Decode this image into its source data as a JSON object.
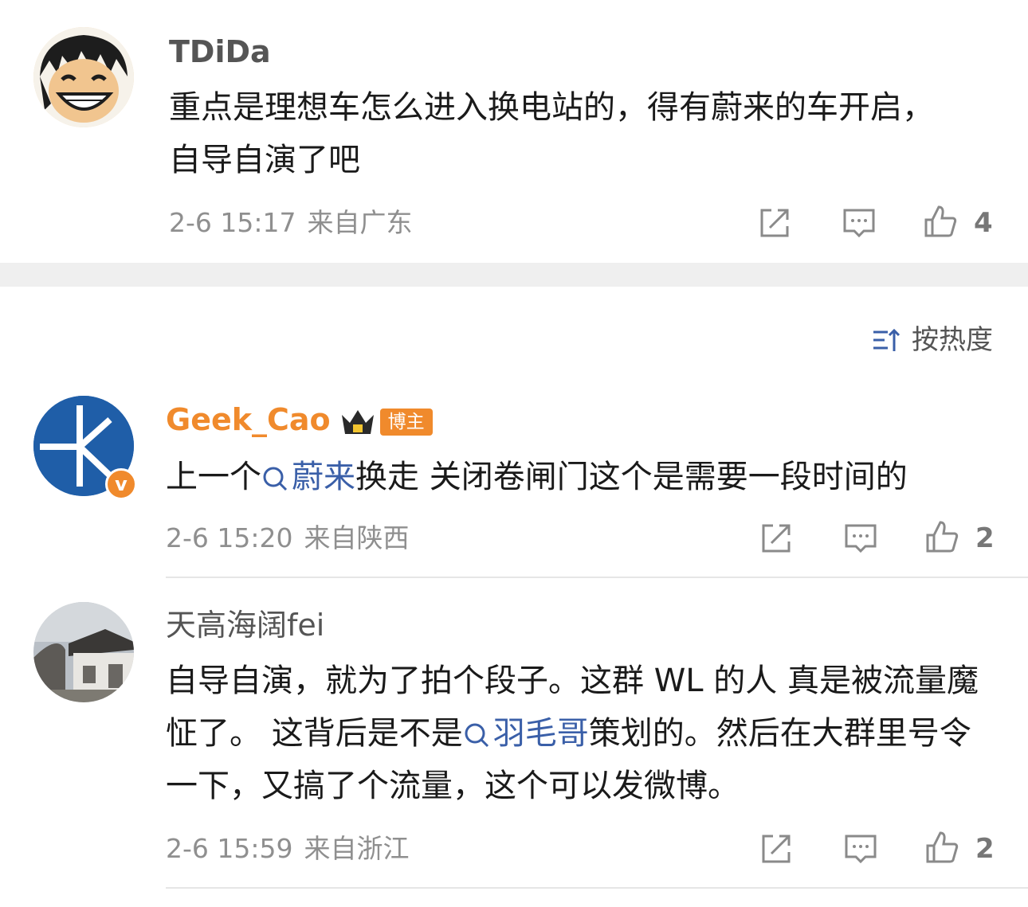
{
  "comments": [
    {
      "username": "TDiDa",
      "text": "重点是理想车怎么进入换电站的，得有蔚来的车开启，自导自演了吧",
      "time": "2-6 15:17",
      "source": "来自广东",
      "likes": "4",
      "avatar_icon": "cartoon-avatar-icon"
    },
    {
      "username": "Geek_Cao",
      "host_badge": "博主",
      "text_before": "上一个",
      "topic": "蔚来",
      "text_after": "换走 关闭卷闸门这个是需要一段时间的",
      "time": "2-6 15:20",
      "source": "来自陕西",
      "likes": "2",
      "verified_mark": "v"
    },
    {
      "username": "天高海阔fei",
      "text_before": "自导自演，就为了拍个段子。这群 WL 的人 真是被流量魔怔了。 这背后是不是",
      "topic": "羽毛哥",
      "text_after": "策划的。然后在大群里号令一下，又搞了个流量，这个可以发微博。",
      "time": "2-6 15:59",
      "source": "来自浙江",
      "likes": "2"
    }
  ],
  "sort_label": "按热度",
  "colors": {
    "accent_orange": "#f08a2c",
    "topic_blue": "#3a5fa8",
    "meta_gray": "#8f8f8f"
  }
}
